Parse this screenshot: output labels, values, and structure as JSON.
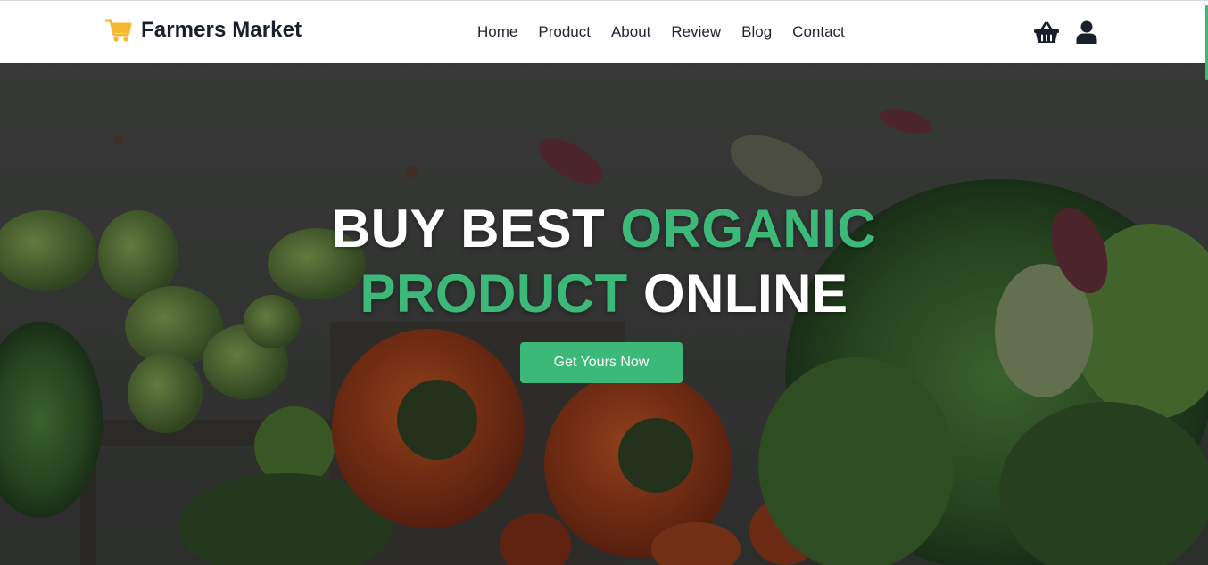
{
  "header": {
    "brand": "Farmers Market",
    "nav": [
      "Home",
      "Product",
      "About",
      "Review",
      "Blog",
      "Contact"
    ],
    "icons": [
      "basket-icon",
      "user-icon"
    ]
  },
  "hero": {
    "title_line1_white": "BUY BEST",
    "title_line1_green": "ORGANIC",
    "title_line2_green": "PRODUCT",
    "title_line2_white": "ONLINE",
    "cta_label": "Get Yours Now"
  },
  "colors": {
    "accent": "#3cb878",
    "brand_icon": "#f5b731",
    "text_dark": "#1a1f2e"
  }
}
